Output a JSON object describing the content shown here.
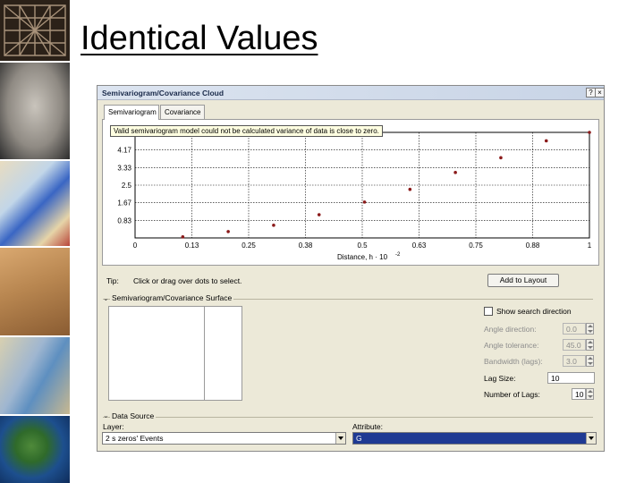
{
  "slide": {
    "title": "Identical Values"
  },
  "dialog": {
    "title": "Semivariogram/Covariance Cloud",
    "help_glyph": "?",
    "close_glyph": "×",
    "tabs": [
      {
        "label": "Semivariogram",
        "active": true
      },
      {
        "label": "Covariance",
        "active": false
      }
    ],
    "warning": "Valid semivariogram model could not be calculated variance of data is close to zero.",
    "tip_label": "Tip:",
    "tip_text": "Click or drag over dots to select.",
    "add_to_layout": "Add to Layout",
    "surface_group": "Semivariogram/Covariance Surface",
    "show_search_direction": "Show search direction",
    "params": [
      {
        "label": "Angle direction:",
        "value": "0.0",
        "disabled": true
      },
      {
        "label": "Angle tolerance:",
        "value": "45.0",
        "disabled": true
      },
      {
        "label": "Bandwidth (lags):",
        "value": "3.0",
        "disabled": true
      },
      {
        "label": "Lag Size:",
        "value": "10",
        "disabled": false
      },
      {
        "label": "Number of Lags:",
        "value": "10",
        "disabled": false
      }
    ],
    "data_source_group": "Data Source",
    "layer_label": "Layer:",
    "layer_value": "2 s zeros' Events",
    "attribute_label": "Attribute:",
    "attribute_value": "G"
  },
  "chart_data": {
    "type": "scatter",
    "xlabel": "Distance, h · 10",
    "xlabel_exponent": "-2",
    "x_ticks": [
      "0",
      "0.13",
      "0.25",
      "0.38",
      "0.5",
      "0.63",
      "0.75",
      "0.88",
      "1"
    ],
    "y_ticks": [
      "0.83",
      "1.67",
      "2.5",
      "3.33",
      "4.17"
    ],
    "xlim": [
      0,
      1
    ],
    "ylim": [
      0,
      5
    ],
    "grid": true,
    "point_color": "#8b1a1a",
    "points": [
      {
        "x": 0.105,
        "y": 0.05
      },
      {
        "x": 0.205,
        "y": 0.3
      },
      {
        "x": 0.305,
        "y": 0.6
      },
      {
        "x": 0.405,
        "y": 1.1
      },
      {
        "x": 0.505,
        "y": 1.7
      },
      {
        "x": 0.605,
        "y": 2.3
      },
      {
        "x": 0.705,
        "y": 3.1
      },
      {
        "x": 0.805,
        "y": 3.8
      },
      {
        "x": 0.905,
        "y": 4.6
      },
      {
        "x": 1.0,
        "y": 5.0
      }
    ]
  }
}
